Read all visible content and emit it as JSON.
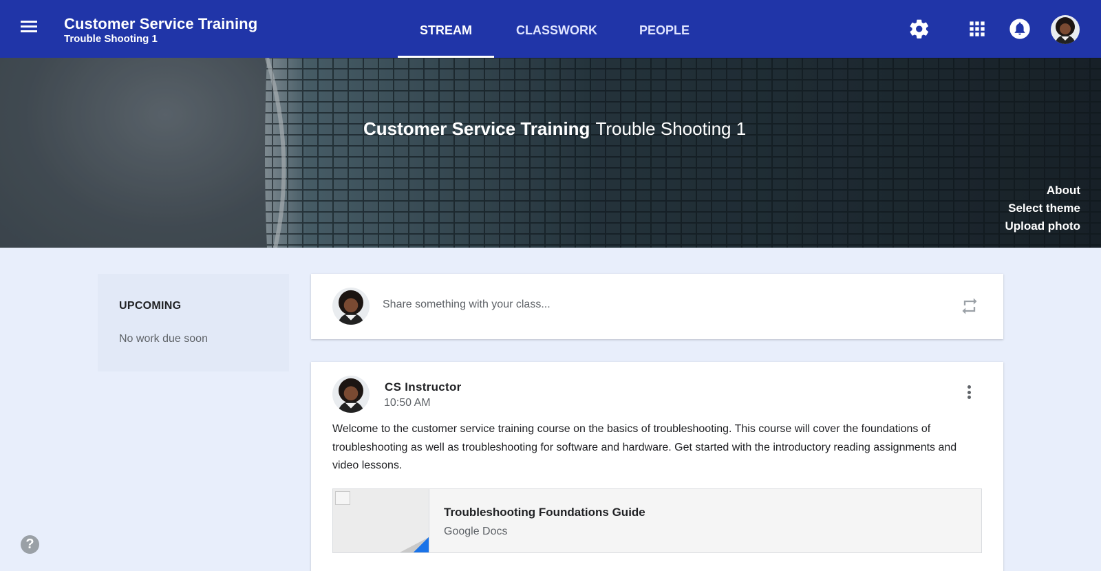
{
  "header": {
    "title": "Customer Service Training",
    "subtitle": "Trouble Shooting 1",
    "tabs": [
      {
        "label": "STREAM",
        "active": true
      },
      {
        "label": "CLASSWORK",
        "active": false
      },
      {
        "label": "PEOPLE",
        "active": false
      }
    ],
    "icons": [
      "menu-icon",
      "gear-icon",
      "apps-grid-icon",
      "bell-icon",
      "avatar"
    ]
  },
  "banner": {
    "title": "Customer Service Training",
    "subtitle": "Trouble Shooting 1",
    "links": [
      "About",
      "Select theme",
      "Upload photo"
    ]
  },
  "upcoming": {
    "heading": "UPCOMING",
    "empty_text": "No work due soon"
  },
  "share": {
    "placeholder": "Share something with your class..."
  },
  "post": {
    "author": "CS Instructor",
    "time": "10:50 AM",
    "body": "Welcome to the customer service training course on the basics of troubleshooting. This course will cover the foundations of troubleshooting as well as troubleshooting for software and hardware. Get started with the introductory reading assignments and video lessons.",
    "attachment": {
      "title": "Troubleshooting Foundations Guide",
      "source": "Google Docs"
    }
  },
  "help": {
    "label": "?"
  },
  "colors": {
    "topbar": "#2035a8",
    "page_background": "#e8eefb",
    "card": "#ffffff"
  }
}
